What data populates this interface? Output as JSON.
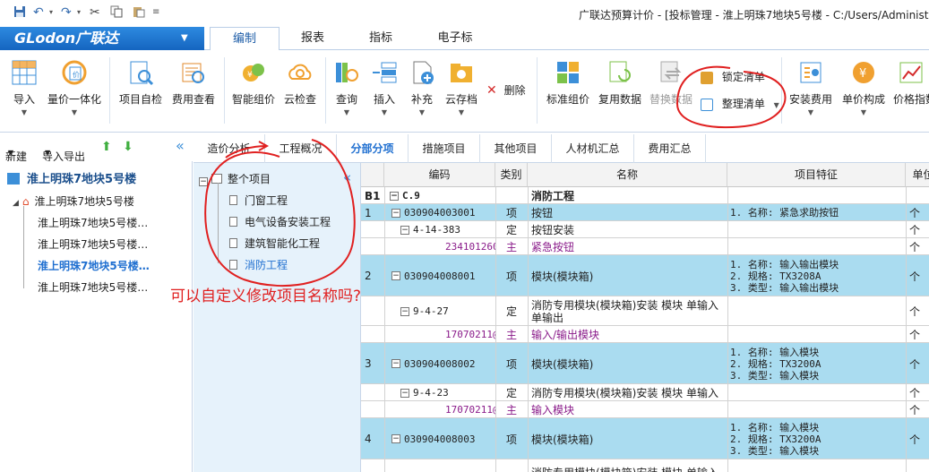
{
  "window_title": "广联达预算计价 - [投标管理 - 淮上明珠7地块5号楼 - C:/Users/Administ",
  "quick_access": [
    "save-icon",
    "undo-icon",
    "undo-dropdown-icon",
    "redo-icon",
    "redo-dropdown-icon",
    "cut-icon",
    "copy-icon",
    "paste-icon",
    "more-icon"
  ],
  "logo": {
    "text": "GLodon广联达"
  },
  "ribbon_tabs": [
    "编制",
    "报表",
    "指标",
    "电子标"
  ],
  "ribbon": {
    "import": "导入",
    "price_unify": "量价一体化",
    "self_check": "项目自检",
    "fee_view": "费用查看",
    "smart_price": "智能组价",
    "cloud_check": "云检查",
    "query": "查询",
    "insert": "插入",
    "supplement": "补充",
    "cloud_archive": "云存档",
    "delete": "删除",
    "std_price": "标准组价",
    "reuse_data": "复用数据",
    "replace_data": "替换数据",
    "lock_list": "锁定清单",
    "organize_list": "整理清单",
    "install_fee": "安装费用",
    "unit_price": "单价构成",
    "price_index": "价格指数"
  },
  "left_toolbar": {
    "new": "新建",
    "import_export": "导入导出"
  },
  "left_tree": {
    "root": "淮上明珠7地块5号楼",
    "child": "淮上明珠7地块5号楼",
    "items": [
      "淮上明珠7地块5号楼…",
      "淮上明珠7地块5号楼…",
      "淮上明珠7地块5号楼…",
      "淮上明珠7地块5号楼…"
    ]
  },
  "doc_tabs": [
    "造价分析",
    "工程概况",
    "分部分项",
    "措施项目",
    "其他项目",
    "人材机汇总",
    "费用汇总"
  ],
  "subtree": {
    "root": "整个项目",
    "items": [
      "门窗工程",
      "电气设备安装工程",
      "建筑智能化工程",
      "消防工程"
    ]
  },
  "grid": {
    "headers": [
      "编码",
      "类别",
      "名称",
      "项目特征",
      "单位"
    ],
    "rows": [
      {
        "num": "B1",
        "code": "C.9",
        "type": "",
        "name": "消防工程",
        "feature": [],
        "unit": ""
      },
      {
        "num": "1",
        "code": "030904003001",
        "type": "项",
        "name": "按钮",
        "feature": [
          "1. 名称: 紧急求助按钮"
        ],
        "unit": "个"
      },
      {
        "num": "",
        "code": "4-14-383",
        "type": "定",
        "name": "按钮安装",
        "feature": [],
        "unit": "个"
      },
      {
        "num": "",
        "code": "2341012607",
        "type": "主",
        "name": "紧急按钮",
        "feature": [],
        "unit": "个"
      },
      {
        "num": "2",
        "code": "030904008001",
        "type": "项",
        "name": "模块(模块箱)",
        "feature": [
          "1. 名称: 输入输出模块",
          "2. 规格: TX3208A",
          "3. 类型: 输入输出模块"
        ],
        "unit": "个"
      },
      {
        "num": "",
        "code": "9-4-27",
        "type": "定",
        "name": "消防专用模块(模块箱)安装 模块 单输入单输出",
        "feature": [],
        "unit": "个"
      },
      {
        "num": "",
        "code": "17070211@1",
        "type": "主",
        "name": "输入/输出模块",
        "feature": [],
        "unit": "个"
      },
      {
        "num": "3",
        "code": "030904008002",
        "type": "项",
        "name": "模块(模块箱)",
        "feature": [
          "1. 名称: 输入模块",
          "2. 规格: TX3200A",
          "3. 类型: 输入模块"
        ],
        "unit": "个"
      },
      {
        "num": "",
        "code": "9-4-23",
        "type": "定",
        "name": "消防专用模块(模块箱)安装 模块 单输入",
        "feature": [],
        "unit": "个"
      },
      {
        "num": "",
        "code": "17070211@3",
        "type": "主",
        "name": "输入模块",
        "feature": [],
        "unit": "个"
      },
      {
        "num": "4",
        "code": "030904008003",
        "type": "项",
        "name": "模块(模块箱)",
        "feature": [
          "1. 名称: 输入模块",
          "2. 规格: TX3200A",
          "3. 类型: 输入模块"
        ],
        "unit": "个"
      },
      {
        "num": "",
        "code": "",
        "type": "",
        "name": "消防专用模块(模块箱)安装 模块 单输入",
        "feature": [],
        "unit": ""
      }
    ]
  },
  "annotation": {
    "text": "可以自定义修改项目名称吗?",
    "color": "#e02020"
  },
  "colors": {
    "accent": "#1f6fd0",
    "row_highlight": "#aadcf0",
    "subtree_bg": "#e6f2fb"
  }
}
